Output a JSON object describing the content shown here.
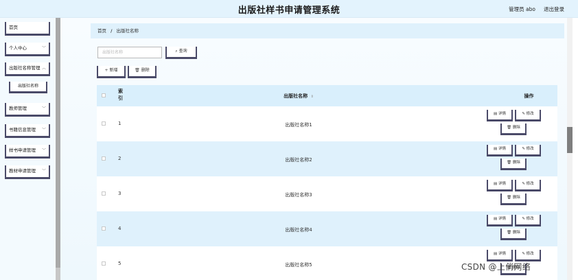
{
  "header": {
    "title": "出版社样书申请管理系统",
    "admin_label": "管理员 abo",
    "logout_label": "退出登录"
  },
  "sidebar": {
    "items": [
      {
        "label": "首页",
        "has_chevron": false
      },
      {
        "label": "个人中心",
        "has_chevron": true
      },
      {
        "label": "出版社名称管理",
        "has_chevron": true
      },
      {
        "label": "出版社名称",
        "sub": true
      },
      {
        "label": "教师管理",
        "has_chevron": true
      },
      {
        "label": "书籍信息管理",
        "has_chevron": true
      },
      {
        "label": "样书申请管理",
        "has_chevron": true
      },
      {
        "label": "教材申请管理",
        "has_chevron": true
      }
    ]
  },
  "breadcrumb": {
    "home": "首页",
    "separator": "/",
    "current": "出版社名称"
  },
  "search": {
    "placeholder": "出版社名称",
    "button": "查询"
  },
  "toolbar": {
    "add": "新增",
    "delete": "删除"
  },
  "table": {
    "columns": {
      "index": "索\n引",
      "name": "出版社名称",
      "ops": "操作"
    },
    "rows": [
      {
        "index": "1",
        "name": "出版社名称1"
      },
      {
        "index": "2",
        "name": "出版社名称2"
      },
      {
        "index": "3",
        "name": "出版社名称3"
      },
      {
        "index": "4",
        "name": "出版社名称4"
      },
      {
        "index": "5",
        "name": "出版社名称5"
      }
    ],
    "actions": {
      "detail": "详情",
      "edit": "修改",
      "delete": "删除"
    }
  },
  "watermark": "CSDN @上俏网络",
  "colors": {
    "accent": "#4a4a68",
    "row_alt": "#dff1fc",
    "header_bg": "#e3f3fd"
  }
}
